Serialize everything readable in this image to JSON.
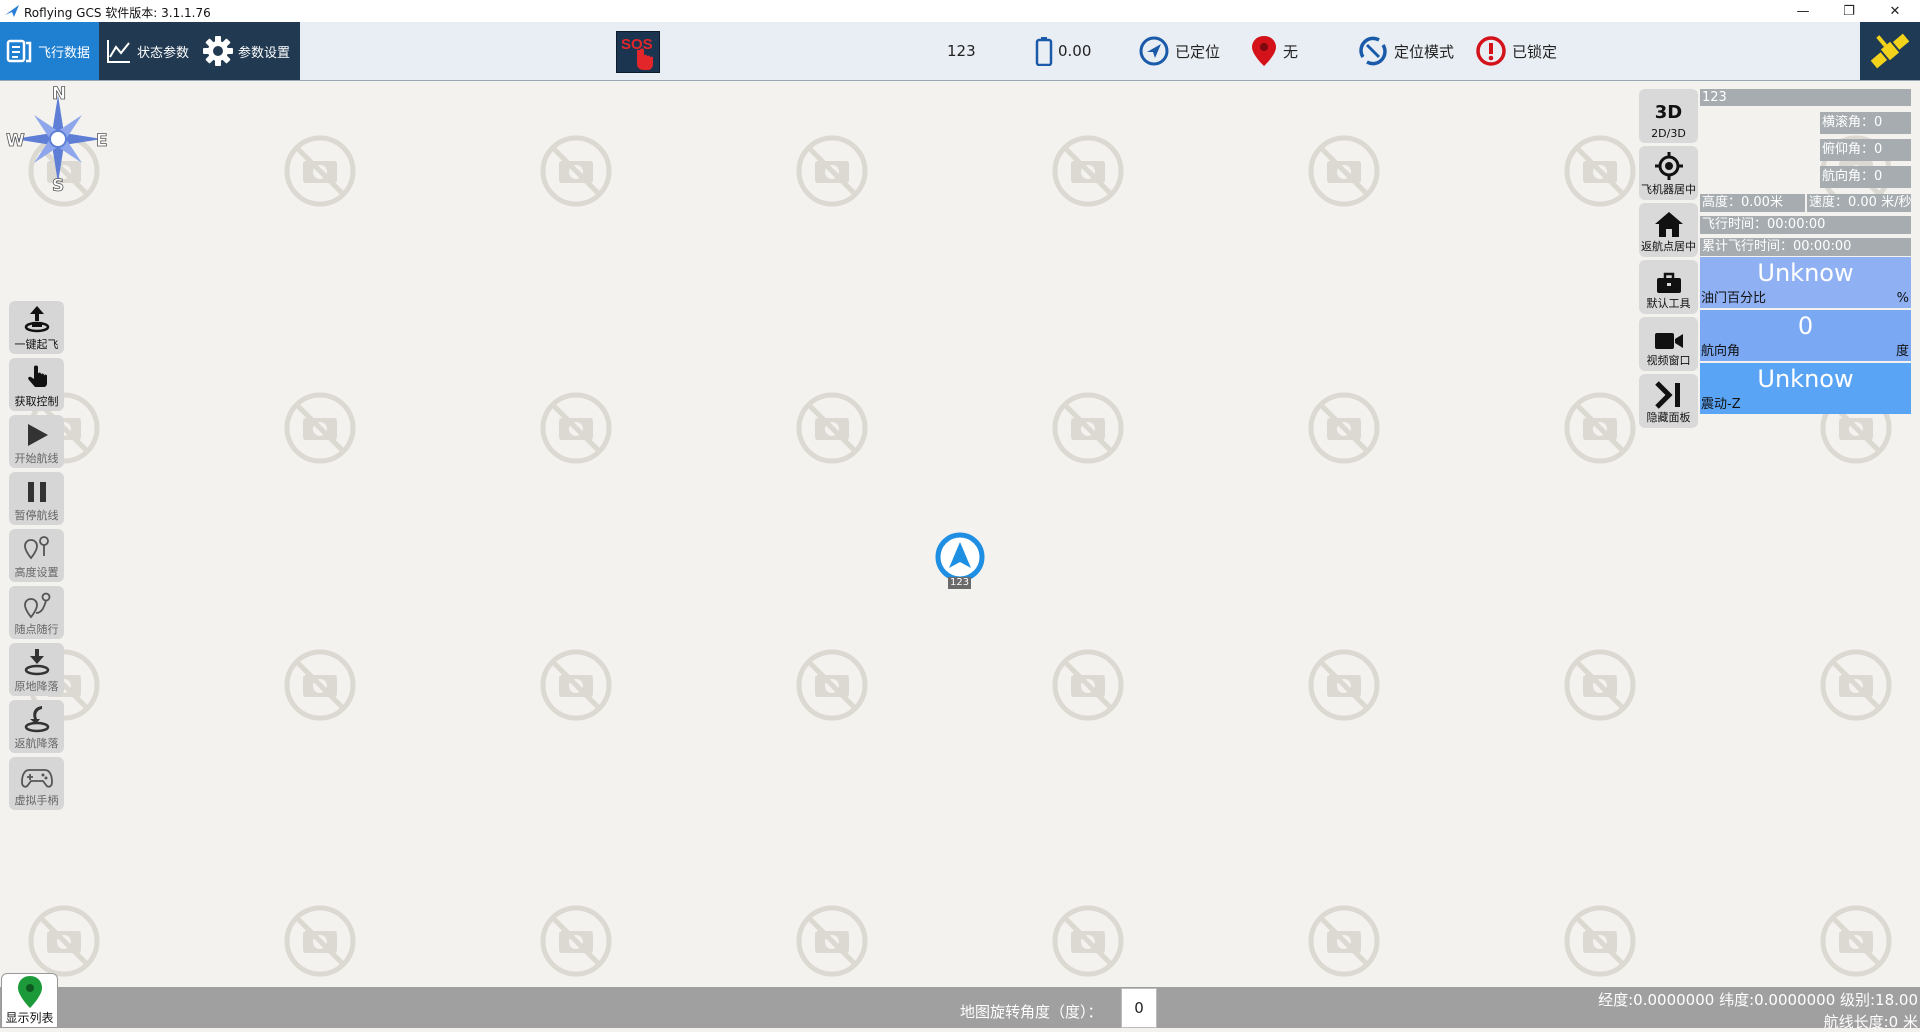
{
  "window": {
    "title": "Roflying GCS 软件版本: 3.1.1.76",
    "controls": [
      "—",
      "❐",
      "✕"
    ]
  },
  "nav": {
    "tabs": [
      {
        "label": "飞行数据",
        "icon": "flight-data-icon",
        "active": true
      },
      {
        "label": "状态参数",
        "icon": "status-chart-icon",
        "active": false
      },
      {
        "label": "参数设置",
        "icon": "gear-icon",
        "active": false
      }
    ]
  },
  "sos": {
    "label": "SOS"
  },
  "status": {
    "vehicle_id": "123",
    "battery": "0.00",
    "gps": "已定位",
    "location": "无",
    "mode": "定位模式",
    "arm_state": "已锁定"
  },
  "compass": {
    "n": "N",
    "s": "S",
    "e": "E",
    "w": "W"
  },
  "left_tools": [
    {
      "label": "一键起飞",
      "icon": "takeoff-icon",
      "enabled": true
    },
    {
      "label": "获取控制",
      "icon": "touch-icon",
      "enabled": true
    },
    {
      "label": "开始航线",
      "icon": "play-icon",
      "enabled": false
    },
    {
      "label": "暂停航线",
      "icon": "pause-icon",
      "enabled": false
    },
    {
      "label": "高度设置",
      "icon": "altitude-pin-icon",
      "enabled": false
    },
    {
      "label": "随点随行",
      "icon": "follow-pin-icon",
      "enabled": false
    },
    {
      "label": "原地降落",
      "icon": "land-icon",
      "enabled": false
    },
    {
      "label": "返航降落",
      "icon": "return-land-icon",
      "enabled": false
    },
    {
      "label": "虚拟手柄",
      "icon": "gamepad-icon",
      "enabled": false
    }
  ],
  "right_tools": [
    {
      "big": "3D",
      "label": "2D/3D",
      "icon": ""
    },
    {
      "big": "",
      "label": "飞机器居中",
      "icon": "crosshair-icon"
    },
    {
      "big": "",
      "label": "返航点居中",
      "icon": "home-icon"
    },
    {
      "big": "",
      "label": "默认工具",
      "icon": "toolbox-icon"
    },
    {
      "big": "",
      "label": "视频窗口",
      "icon": "video-camera-icon"
    },
    {
      "big": "",
      "label": "隐藏面板",
      "icon": "hide-panel-icon"
    }
  ],
  "info_panel": {
    "vehicle_name": "123",
    "roll": "横滚角：0",
    "pitch": "俯仰角：0",
    "yaw": "航向角：0",
    "altitude": "高度：0.00米",
    "speed": "速度：0.00 米/秒",
    "flight_time": "飞行时间：00:00:00",
    "total_time": "累计飞行时间：00:00:00",
    "gauges": [
      {
        "value": "Unknow",
        "label": "油门百分比",
        "unit": "%",
        "color": "#8fb0f2"
      },
      {
        "value": "0",
        "label": "航向角",
        "unit": "度",
        "color": "#7aa8f2"
      },
      {
        "value": "Unknow",
        "label": "震动-Z",
        "unit": "",
        "color": "#5aa4f5"
      }
    ]
  },
  "aircraft": {
    "label": "123",
    "color": "#1e8fe3"
  },
  "bottom": {
    "show_list": "显示列表",
    "rotation_label": "地图旋转角度（度）：",
    "rotation_value": "0",
    "coords": "经度:0.0000000 纬度:0.0000000 级别:18.00",
    "route_length": "航线长度:0 米"
  }
}
